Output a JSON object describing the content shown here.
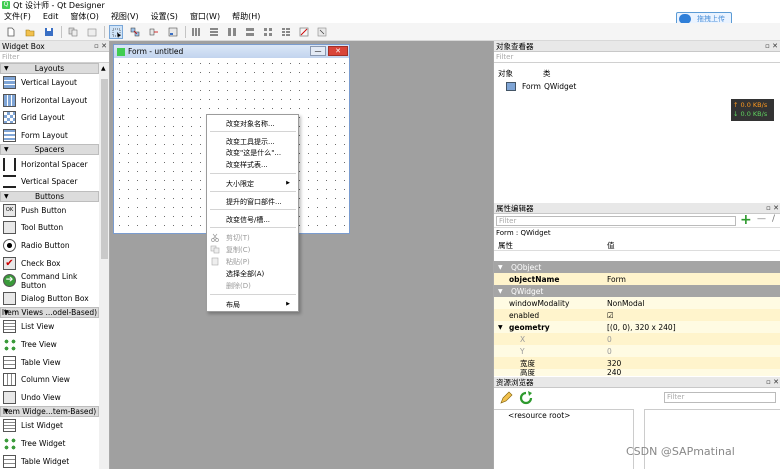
{
  "window": {
    "title": "Qt 设计师 - Qt Designer",
    "app_icon": "qt-icon"
  },
  "menubar": {
    "items": [
      "文件(F)",
      "Edit",
      "窗体(O)",
      "视图(V)",
      "设置(S)",
      "窗口(W)",
      "帮助(H)"
    ]
  },
  "upload_button": {
    "label": "拖拽上传"
  },
  "widget_box": {
    "title": "Widget Box",
    "filter_placeholder": "Filter",
    "categories": {
      "layouts": "Layouts",
      "spacers": "Spacers",
      "buttons": "Buttons",
      "item_views": "Item Views ...odel-Based)",
      "item_widgets": "Item Widge...tem-Based)"
    },
    "items": {
      "vertical_layout": "Vertical Layout",
      "horizontal_layout": "Horizontal Layout",
      "grid_layout": "Grid Layout",
      "form_layout": "Form Layout",
      "horizontal_spacer": "Horizontal Spacer",
      "vertical_spacer": "Vertical Spacer",
      "push_button": "Push Button",
      "tool_button": "Tool Button",
      "radio_button": "Radio Button",
      "check_box": "Check Box",
      "command_link_button": "Command Link Button",
      "dialog_button_box": "Dialog Button Box",
      "list_view": "List View",
      "tree_view": "Tree View",
      "table_view": "Table View",
      "column_view": "Column View",
      "undo_view": "Undo View",
      "list_widget": "List Widget",
      "tree_widget": "Tree Widget",
      "table_widget": "Table Widget"
    }
  },
  "form": {
    "title": "Form - untitled",
    "min_label": "—",
    "close_label": "✕"
  },
  "context_menu": {
    "change_object_name": "改变对象名称...",
    "change_tooltip": "改变工具提示...",
    "change_whatsthis": "改变\"这是什么\"...",
    "change_stylesheet": "改变样式表...",
    "size_constraints": "大小限定",
    "promote_to": "提升的窗口部件...",
    "change_signals": "改变信号/槽...",
    "cut": "剪切(T)",
    "copy": "复制(C)",
    "paste": "粘贴(P)",
    "select_all": "选择全部(A)",
    "delete": "删除(D)",
    "layout": "布局",
    "arrow": "▶"
  },
  "object_inspector": {
    "title": "对象查看器",
    "filter_placeholder": "Filter",
    "col_object": "对象",
    "col_class": "类",
    "row": {
      "object": "Form",
      "class": "QWidget"
    }
  },
  "net_widget": {
    "up": "↑ 0.0 KB/s",
    "down": "↓ 0.0 KB/s"
  },
  "property_editor": {
    "title": "属性编辑器",
    "filter_placeholder": "Filter",
    "context": "Form : QWidget",
    "col_property": "属性",
    "col_value": "值",
    "add_label": "+",
    "remove_label": "—",
    "groups": {
      "qobject": "QObject",
      "qwidget": "QWidget"
    },
    "rows": {
      "object_name": {
        "name": "objectName",
        "value": "Form"
      },
      "window_modality": {
        "name": "windowModality",
        "value": "NonModal"
      },
      "enabled": {
        "name": "enabled",
        "value": "☑"
      },
      "geometry": {
        "name": "geometry",
        "value": "[(0, 0), 320 x 240]"
      },
      "x": {
        "name": "X",
        "value": "0"
      },
      "y": {
        "name": "Y",
        "value": "0"
      },
      "width": {
        "name": "宽度",
        "value": "320"
      },
      "height": {
        "name": "高度",
        "value": "240"
      }
    }
  },
  "resource_browser": {
    "title": "资源浏览器",
    "filter_placeholder": "Filter",
    "root_label": "<resource root>"
  },
  "watermark": "CSDN @SAPmatinal",
  "colors": {
    "qt_green": "#41cd52",
    "group_gray": "#a5a5a5",
    "prop_yellow": "#fff4cc",
    "canvas_gray": "#a0a0a0"
  }
}
